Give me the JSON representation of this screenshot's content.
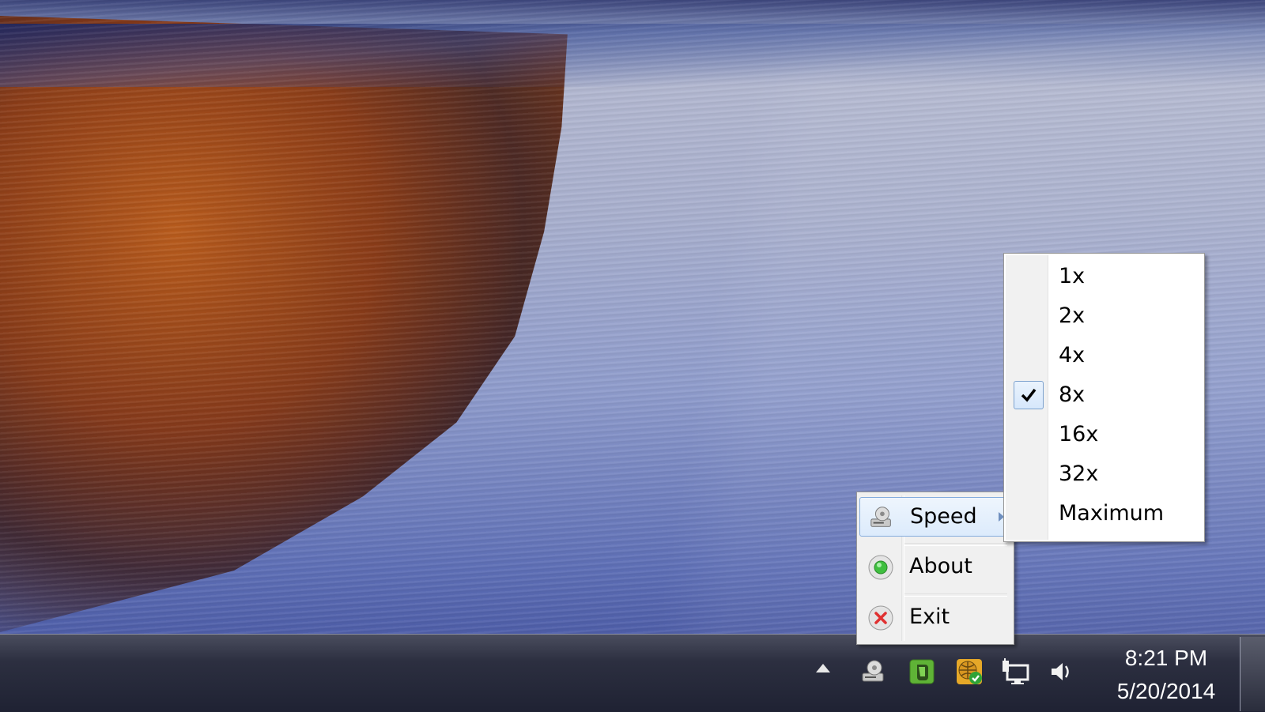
{
  "context_menu": {
    "items": [
      {
        "label": "Speed",
        "icon": "speed-app-icon",
        "has_submenu": true,
        "active": true
      },
      {
        "label": "About",
        "icon": "green-circle-icon"
      },
      {
        "label": "Exit",
        "icon": "red-x-icon"
      }
    ]
  },
  "speed_submenu": {
    "items": [
      {
        "label": "1x"
      },
      {
        "label": "2x"
      },
      {
        "label": "4x"
      },
      {
        "label": "8x",
        "checked": true
      },
      {
        "label": "16x"
      },
      {
        "label": "32x"
      },
      {
        "label": "Maximum"
      }
    ]
  },
  "taskbar": {
    "tray_icons": [
      "show-hidden-icons-arrow",
      "speed-app-icon",
      "evernote-icon",
      "network-globe-check-icon",
      "network-monitor-icon",
      "volume-icon"
    ],
    "clock": {
      "time": "8:21 PM",
      "date": "5/20/2014"
    }
  },
  "colors": {
    "menu_background": "#f0f0f0",
    "menu_highlight_border": "#84acdd",
    "taskbar": "#2c2f40"
  }
}
